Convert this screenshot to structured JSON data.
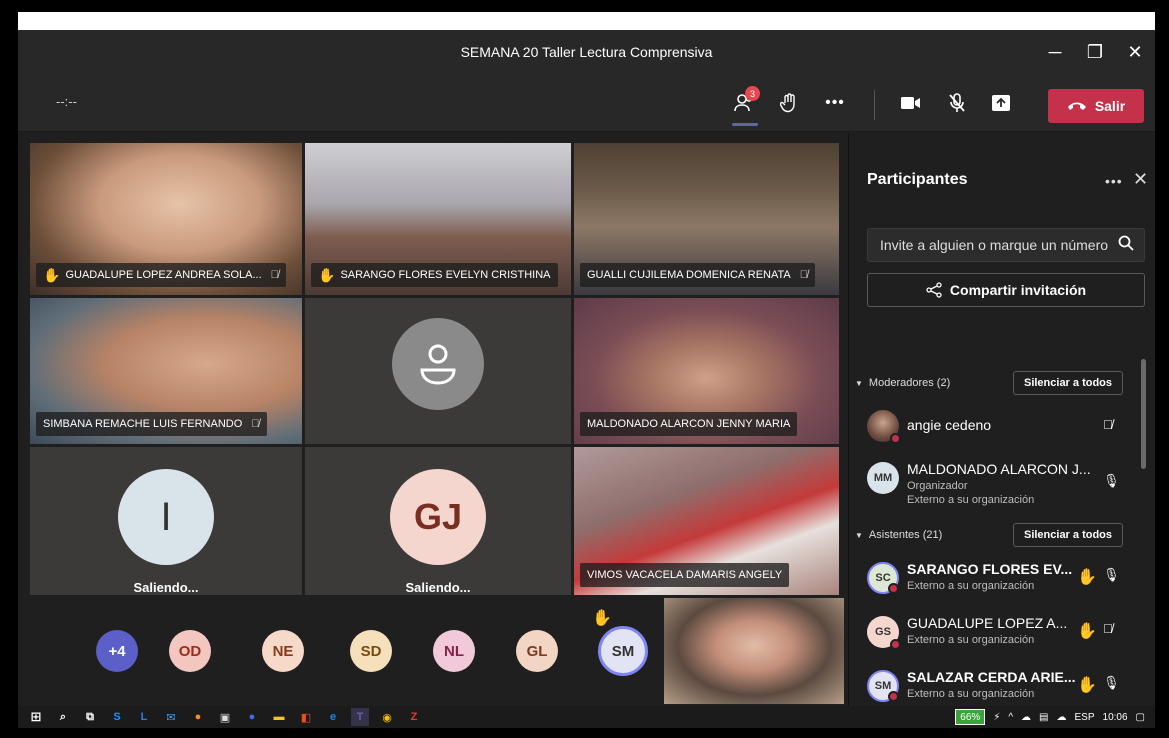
{
  "window": {
    "title": "SEMANA 20 Taller Lectura Comprensiva"
  },
  "toolbar": {
    "timer": "--:--",
    "people_badge": "3",
    "leave_label": "Salir"
  },
  "tiles": [
    {
      "name": "GUADALUPE LOPEZ ANDREA SOLA...",
      "hand": true,
      "muted": true
    },
    {
      "name": "SARANGO FLORES EVELYN CRISTHINA",
      "hand": true,
      "muted": false
    },
    {
      "name": "GUALLI CUJILEMA DOMENICA RENATA",
      "hand": false,
      "muted": true
    },
    {
      "name": "SIMBANA REMACHE LUIS FERNANDO",
      "hand": false,
      "muted": true
    },
    {
      "name": "",
      "hand": false,
      "muted": false
    },
    {
      "name": "MALDONADO ALARCON JENNY MARIA",
      "hand": false,
      "muted": false
    },
    {
      "initials": "I",
      "status": "Saliendo..."
    },
    {
      "initials": "GJ",
      "status": "Saliendo..."
    },
    {
      "name": "VIMOS VACACELA DAMARIS ANGELY",
      "hand": false,
      "muted": false
    }
  ],
  "strip": [
    {
      "initials": "+4",
      "color": "#5b5fc7"
    },
    {
      "initials": "OD",
      "color": "#f3c7c0"
    },
    {
      "initials": "NE",
      "color": "#f6d9c8"
    },
    {
      "initials": "SD",
      "color": "#f5e0bb"
    },
    {
      "initials": "NL",
      "color": "#f1c9d8"
    },
    {
      "initials": "GL",
      "color": "#f3d5c4"
    },
    {
      "initials": "SM",
      "color": "#e2e3f3"
    }
  ],
  "panel": {
    "title": "Participantes",
    "invite_placeholder": "Invite a alguien o marque un número",
    "share_label": "Compartir invitación",
    "moderators_header": "Moderadores (2)",
    "attendees_header": "Asistentes (21)",
    "mute_all_label": "Silenciar a todos",
    "moderators": [
      {
        "name": "angie cedeno",
        "initials": "",
        "role": "",
        "org": ""
      },
      {
        "name": "MALDONADO ALARCON J...",
        "initials": "MM",
        "role": "Organizador",
        "org": "Externo a su organización"
      }
    ],
    "attendees": [
      {
        "name": "SARANGO FLORES EV...",
        "initials": "SC",
        "org": "Externo a su organización"
      },
      {
        "name": "GUADALUPE LOPEZ A...",
        "initials": "GS",
        "org": "Externo a su organización"
      },
      {
        "name": "SALAZAR CERDA ARIE...",
        "initials": "SM",
        "org": "Externo a su organización"
      }
    ]
  },
  "taskbar": {
    "battery": "66%",
    "lang": "ESP",
    "time": "10:06"
  }
}
